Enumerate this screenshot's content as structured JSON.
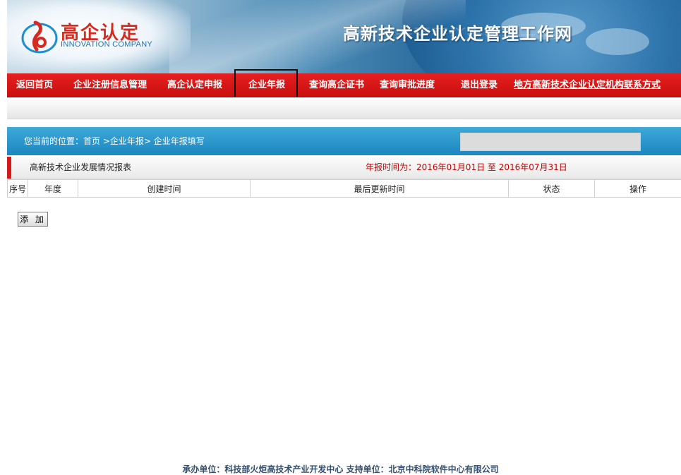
{
  "logo": {
    "cn": "高企认定",
    "en": "INNOVATION COMPANY"
  },
  "site_title": "高新技术企业认定管理工作网",
  "nav": {
    "items": [
      {
        "label": "返回首页"
      },
      {
        "label": "企业注册信息管理"
      },
      {
        "label": "高企认定申报"
      },
      {
        "label": "企业年报",
        "highlighted": true
      },
      {
        "label": "查询高企证书"
      },
      {
        "label": "查询审批进度"
      },
      {
        "label": "退出登录"
      },
      {
        "label": "地方高新技术企业认定机构联系方式"
      }
    ]
  },
  "location": {
    "text": "您当前的位置：首页  >企业年报>  企业年报填写"
  },
  "report": {
    "title": "高新技术企业发展情况报表",
    "period": "年报时间为：2016年01月01日 至 2016年07月31日"
  },
  "table": {
    "columns": [
      "序号",
      "年度",
      "创建时间",
      "最后更新时间",
      "状态",
      "操作"
    ]
  },
  "add_button": "添 加",
  "footer": "承办单位：科技部火炬高技术产业开发中心    支持单位：北京中科院软件中心有限公司",
  "colors": {
    "nav_red": "#d61515",
    "location_blue": "#2a97cc",
    "period_red": "#c40000",
    "accent_red": "#d21a1a"
  }
}
